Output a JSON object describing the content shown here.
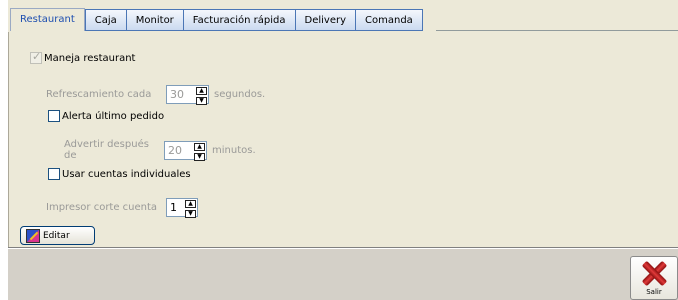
{
  "tabs": [
    {
      "label": "Restaurant",
      "active": true
    },
    {
      "label": "Caja",
      "active": false
    },
    {
      "label": "Monitor",
      "active": false
    },
    {
      "label": "Facturación rápida",
      "active": false
    },
    {
      "label": "Delivery",
      "active": false
    },
    {
      "label": "Comanda",
      "active": false
    }
  ],
  "restaurant": {
    "maneja_label": "Maneja restaurant",
    "maneja_checked": true,
    "refresh_label": "Refrescamiento cada",
    "refresh_value": "30",
    "refresh_unit": "segundos.",
    "alert_label": "Alerta último pedido",
    "alert_checked": false,
    "warn_label": "Advertir después de",
    "warn_value": "20",
    "warn_unit": "minutos.",
    "individual_label": "Usar cuentas individuales",
    "individual_checked": false,
    "printer_label": "Impresor corte cuenta",
    "printer_value": "1",
    "edit_label": "Editar"
  },
  "footer": {
    "exit_label": "Salir"
  },
  "icons": {
    "edit": "edit-icon",
    "exit": "close-x-icon",
    "spin": "spin-arrows-icon"
  }
}
